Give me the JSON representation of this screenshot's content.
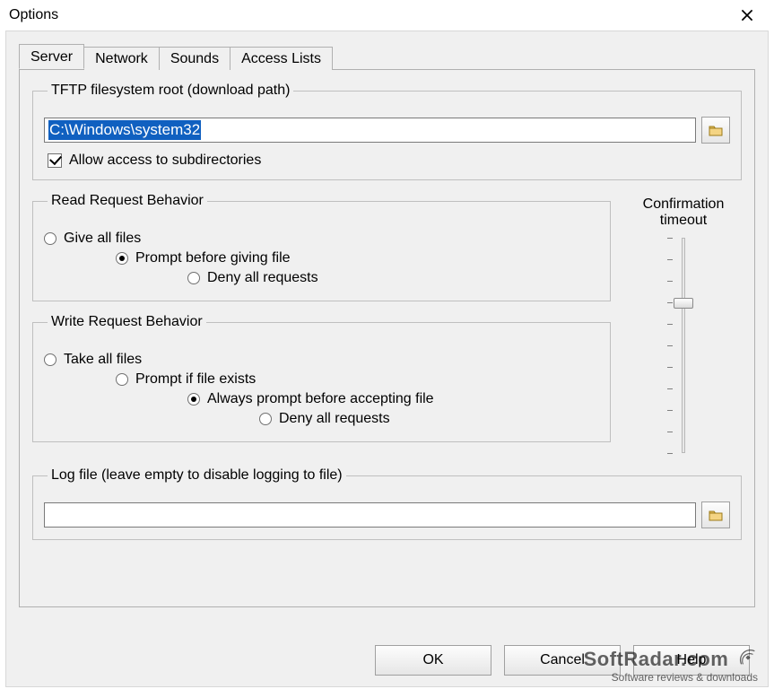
{
  "window": {
    "title": "Options"
  },
  "tabs": [
    {
      "label": "Server",
      "active": true
    },
    {
      "label": "Network",
      "active": false
    },
    {
      "label": "Sounds",
      "active": false
    },
    {
      "label": "Access Lists",
      "active": false
    }
  ],
  "tftp_root": {
    "legend": "TFTP filesystem root (download path)",
    "value": "C:\\Windows\\system32",
    "browse_icon": "folder-icon",
    "allow_subdirs_label": "Allow access to subdirectories",
    "allow_subdirs_checked": true
  },
  "read_behavior": {
    "legend": "Read Request Behavior",
    "options": [
      {
        "label": "Give all files",
        "selected": false,
        "indent": 0
      },
      {
        "label": "Prompt before giving file",
        "selected": true,
        "indent": 1
      },
      {
        "label": "Deny all requests",
        "selected": false,
        "indent": 2
      }
    ]
  },
  "write_behavior": {
    "legend": "Write Request Behavior",
    "options": [
      {
        "label": "Take all files",
        "selected": false,
        "indent": 0
      },
      {
        "label": "Prompt if file exists",
        "selected": false,
        "indent": 1
      },
      {
        "label": "Always prompt before accepting file",
        "selected": true,
        "indent": 2
      },
      {
        "label": "Deny all requests",
        "selected": false,
        "indent": 3
      }
    ]
  },
  "confirmation": {
    "label_line1": "Confirmation",
    "label_line2": "timeout",
    "slider_value_pct": 28
  },
  "log_file": {
    "legend": "Log file (leave empty to disable logging to file)",
    "value": "",
    "browse_icon": "folder-icon"
  },
  "buttons": {
    "ok": "OK",
    "cancel": "Cancel",
    "help": "Help"
  },
  "watermark": {
    "brand": "SoftRadar.com",
    "tagline": "Software reviews & downloads"
  }
}
